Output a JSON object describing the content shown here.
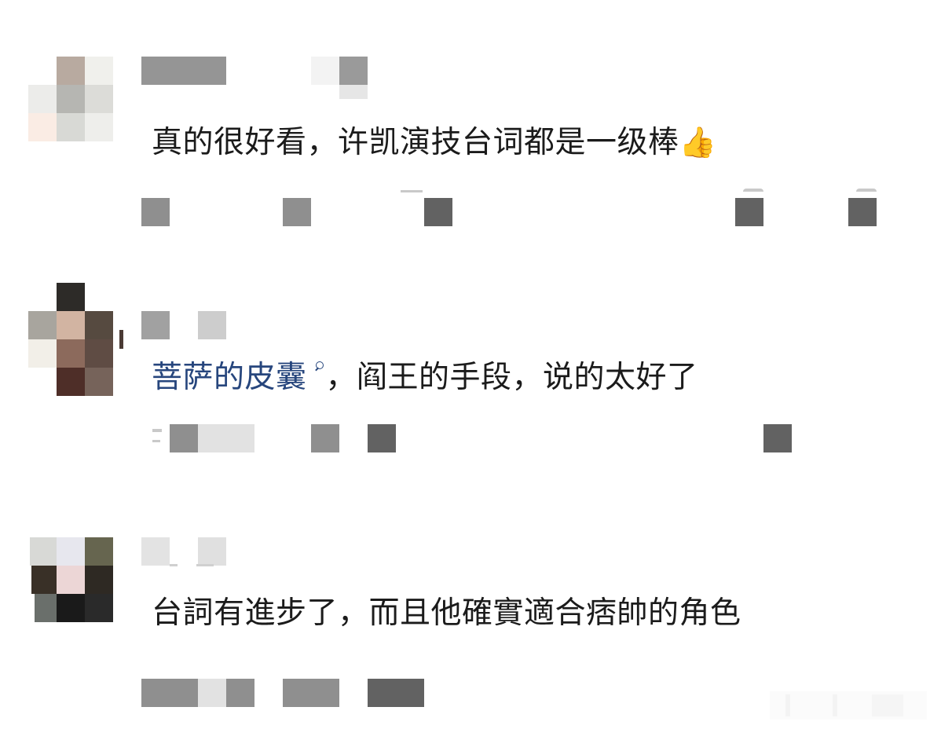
{
  "comments": [
    {
      "text": "真的很好看，许凯演技台词都是一级棒",
      "emoji": "👍"
    },
    {
      "topic": "菩萨的皮囊",
      "text": "，阎王的手段，说的太好了"
    },
    {
      "text": "台詞有進步了，而且他確實適合痞帥的角色"
    }
  ],
  "colors": {
    "text": "#1b1b1b",
    "link": "#27467d",
    "mosaic_gray": "#8f8f8f",
    "mosaic_dark": "#5f5f5f"
  }
}
